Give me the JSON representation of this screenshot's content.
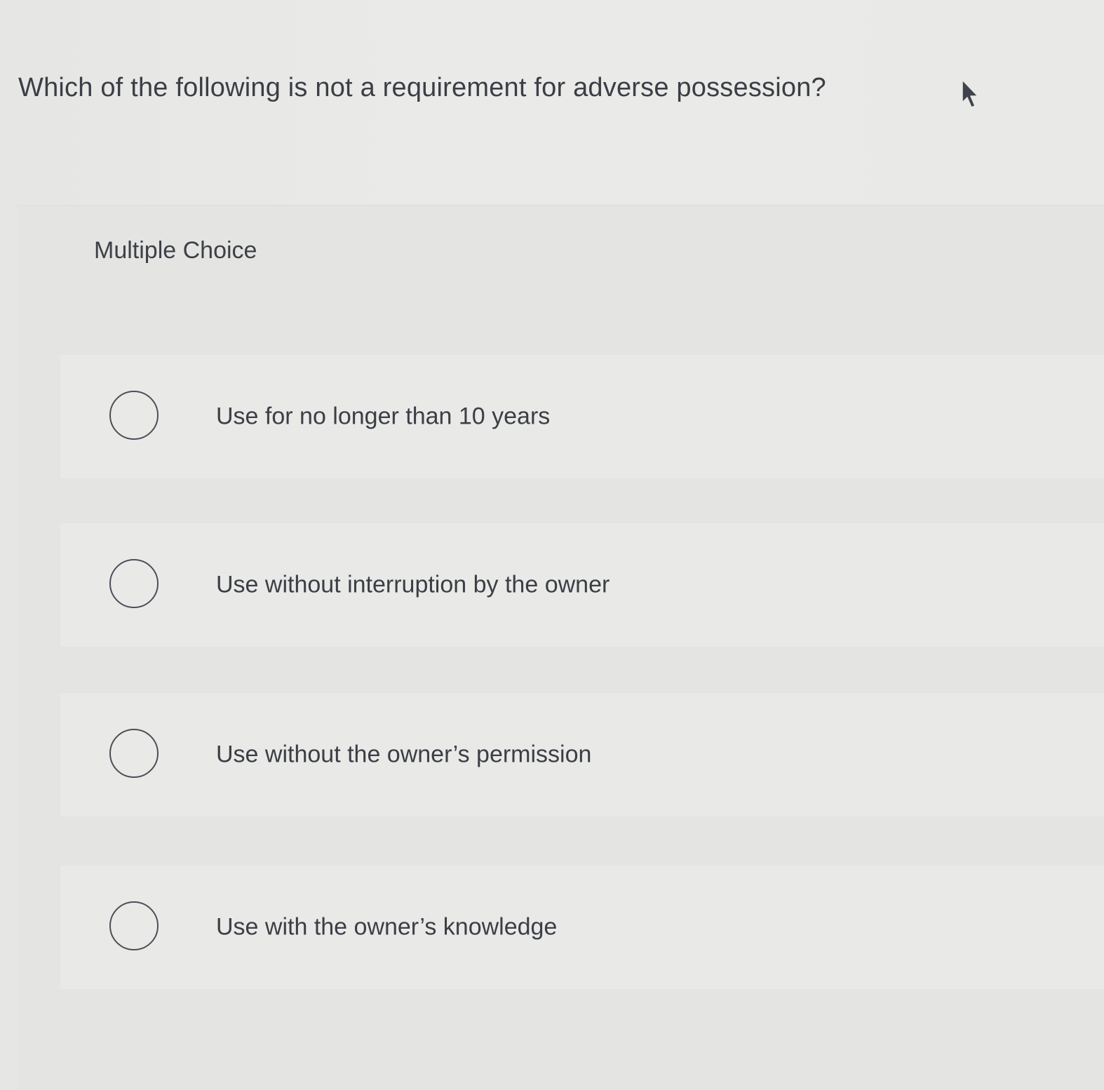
{
  "question": {
    "text": "Which of the following is not a requirement for adverse possession?"
  },
  "card": {
    "label": "Multiple Choice",
    "options": [
      {
        "label": "Use for no longer than 10 years",
        "selected": false
      },
      {
        "label": "Use without interruption by the owner",
        "selected": false
      },
      {
        "label": "Use without the owner’s permission",
        "selected": false
      },
      {
        "label": "Use with the owner’s knowledge",
        "selected": false
      }
    ]
  },
  "colors": {
    "text": "#3b3e45",
    "radio_border": "#4b4f58",
    "background": "#e8e8e6"
  },
  "icons": {
    "pointer": "mouse-pointer-icon"
  }
}
